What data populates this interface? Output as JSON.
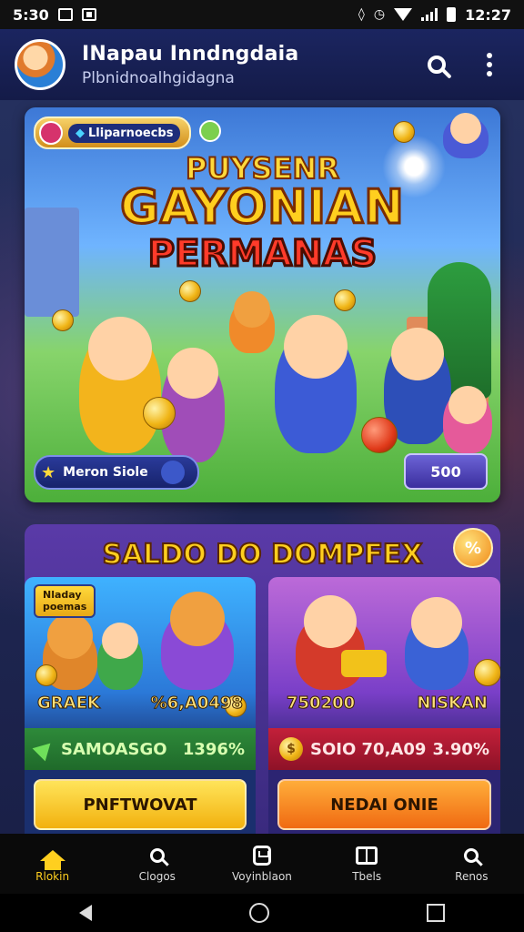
{
  "status_bar": {
    "left_time": "5:30",
    "right_time": "12:27"
  },
  "header": {
    "title": "INapau Inndngdaia",
    "subtitle": "Plbnidnoalhgidagna",
    "search_icon": "search-icon",
    "menu_icon": "more-vert-icon"
  },
  "hero": {
    "badge_text": "Lliparnoecbs",
    "title_line1": "PUYSENR",
    "title_line2": "GAYONIAN",
    "title_line3": "PERMANAS",
    "label": "Meron Siole",
    "price": "500"
  },
  "section": {
    "title": "SALDO DO DOMPFEX",
    "cards": [
      {
        "tag_line1": "Nladay",
        "tag_line2": "poemas",
        "name": "GRAEK",
        "price": "%6,A0498",
        "bar_left": "SAMOASGO",
        "bar_right": "1396%",
        "button": "PNFTWOVAT"
      },
      {
        "name": "750200",
        "price": "NISKAN",
        "bar_left": "SOIO 70,A09",
        "bar_right": "3.90%",
        "button": "NEDAI ONIE"
      }
    ]
  },
  "bottom_nav": [
    {
      "label": "Rlokin",
      "icon": "home-icon",
      "active": true
    },
    {
      "label": "Clogos",
      "icon": "search-icon",
      "active": false
    },
    {
      "label": "Voyinblaon",
      "icon": "bag-icon",
      "active": false
    },
    {
      "label": "Tbels",
      "icon": "book-icon",
      "active": false
    },
    {
      "label": "Renos",
      "icon": "search-icon",
      "active": false
    }
  ],
  "colors": {
    "accent": "#ffcf1f",
    "header_bg": "#1b2560",
    "buy_button_left": "#f2b10e",
    "buy_button_right": "#f06a12"
  }
}
